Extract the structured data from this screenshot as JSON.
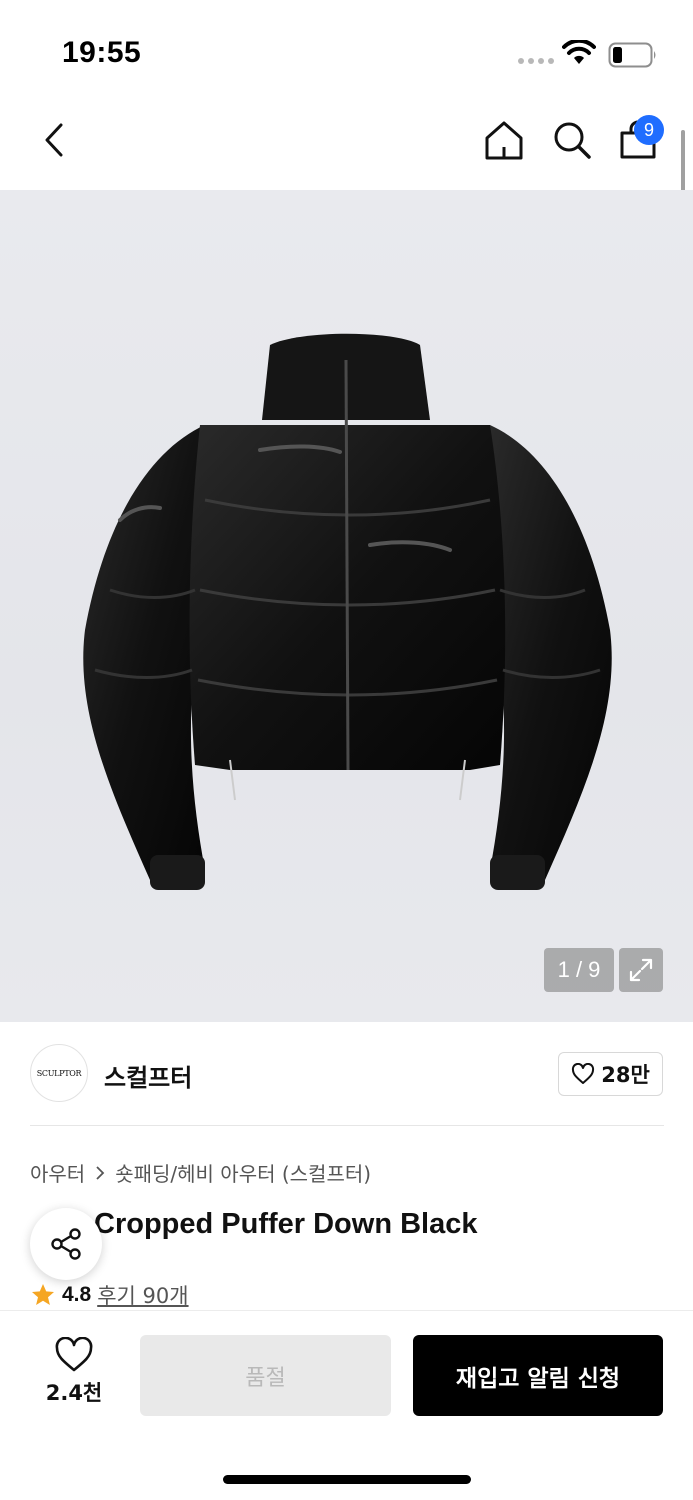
{
  "status_bar": {
    "time": "19:55"
  },
  "header": {
    "back_icon": "chevron-left-icon",
    "home_icon": "home-icon",
    "search_icon": "search-icon",
    "cart_icon": "shopping-bag-icon",
    "cart_count": "9",
    "badge_color": "#1f6dff"
  },
  "gallery": {
    "counter": "1 / 9",
    "expand_icon": "expand-icon"
  },
  "brand": {
    "logo_text": "SCULPTOR",
    "name": "스컬프터",
    "like_icon": "heart-outline-icon",
    "like_count": "28만"
  },
  "product": {
    "breadcrumb": [
      "아우터",
      "숏패딩/헤비 아우터 (스컬프터)"
    ],
    "title": "Cropped Puffer Down Black",
    "rating": "4.8",
    "reviews": "후기 90개",
    "star_color": "#f5a623"
  },
  "bottom_bar": {
    "wish_count": "2.4천",
    "soldout_label": "품절",
    "restock_label": "재입고 알림 신청"
  }
}
